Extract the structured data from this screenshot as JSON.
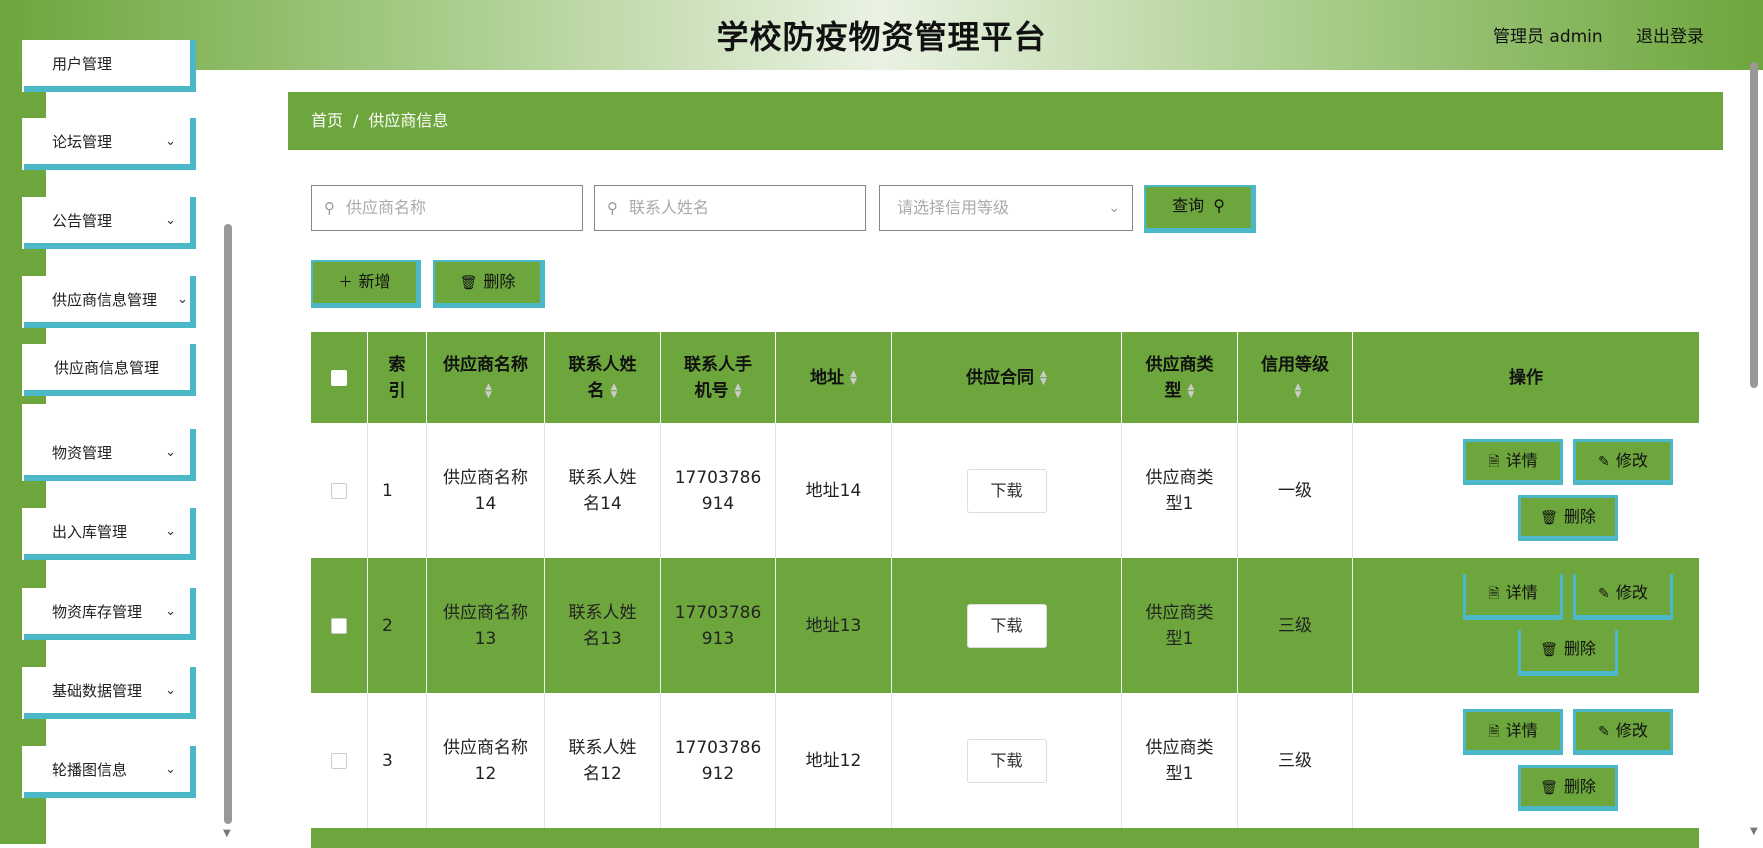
{
  "header": {
    "title": "学校防疫物资管理平台",
    "user": "管理员 admin",
    "logout": "退出登录"
  },
  "sidebar": {
    "items": [
      {
        "label": "用户管理"
      },
      {
        "label": "论坛管理"
      },
      {
        "label": "公告管理"
      },
      {
        "label": "供应商信息管理"
      },
      {
        "label": "供应商信息管理"
      },
      {
        "label": "物资管理"
      },
      {
        "label": "出入库管理"
      },
      {
        "label": "物资库存管理"
      },
      {
        "label": "基础数据管理"
      },
      {
        "label": "轮播图信息"
      }
    ]
  },
  "breadcrumb": {
    "home": "首页",
    "separator": "/",
    "current": "供应商信息"
  },
  "search": {
    "name_placeholder": "供应商名称",
    "contact_placeholder": "联系人姓名",
    "credit_placeholder": "请选择信用等级",
    "query_label": "查询"
  },
  "actions": {
    "add_label": "新增",
    "delete_label": "删除"
  },
  "table": {
    "columns": [
      "索引",
      "供应商名称",
      "联系人姓名",
      "联系人手机号",
      "地址",
      "供应合同",
      "供应商类型",
      "信用等级",
      "操作"
    ],
    "col_lines": {
      "index": [
        "索",
        "引"
      ],
      "name": "供应商名称",
      "contact": [
        "联系人姓",
        "名"
      ],
      "phone": [
        "联系人手",
        "机号"
      ],
      "address": "地址",
      "contract": "供应合同",
      "type": [
        "供应商类",
        "型"
      ],
      "credit": "信用等级",
      "ops": "操作"
    },
    "rows": [
      {
        "index": "1",
        "name": [
          "供应商名称",
          "14"
        ],
        "contact": [
          "联系人姓",
          "名14"
        ],
        "phone": [
          "17703786",
          "914"
        ],
        "address": "地址14",
        "contract": "下载",
        "type": [
          "供应商类",
          "型1"
        ],
        "credit": "一级"
      },
      {
        "index": "2",
        "name": [
          "供应商名称",
          "13"
        ],
        "contact": [
          "联系人姓",
          "名13"
        ],
        "phone": [
          "17703786",
          "913"
        ],
        "address": "地址13",
        "contract": "下载",
        "type": [
          "供应商类",
          "型1"
        ],
        "credit": "三级"
      },
      {
        "index": "3",
        "name": [
          "供应商名称",
          "12"
        ],
        "contact": [
          "联系人姓",
          "名12"
        ],
        "phone": [
          "17703786",
          "912"
        ],
        "address": "地址12",
        "contract": "下载",
        "type": [
          "供应商类",
          "型1"
        ],
        "credit": "三级"
      }
    ],
    "ops": {
      "detail": "详情",
      "edit": "修改",
      "delete": "删除"
    }
  },
  "colors": {
    "accent": "#6da63c",
    "border_accent": "#4bb8c8"
  }
}
